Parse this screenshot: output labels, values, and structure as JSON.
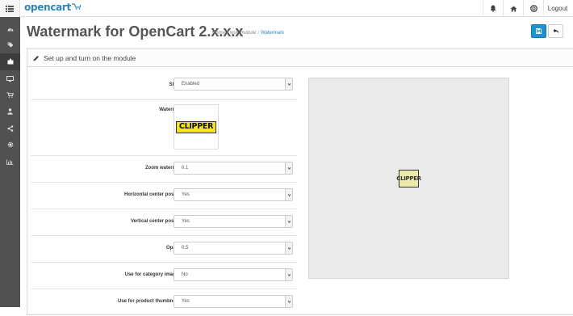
{
  "header": {
    "brand": "opencart",
    "logout_label": "Logout"
  },
  "page": {
    "title": "Watermark for OpenCart 2.x.x.x",
    "breadcrumb": [
      "Home",
      "test_module",
      "Watermark"
    ]
  },
  "panel": {
    "heading": "Set up and turn on the module"
  },
  "form": {
    "status": {
      "label": "Status",
      "value": "Enabled"
    },
    "watermark": {
      "label": "Watermark",
      "image_text": "CLIPPER"
    },
    "zoom": {
      "label": "Zoom watermark",
      "value": "0.1"
    },
    "h_center": {
      "label": "Horizontal center position",
      "value": "Yes"
    },
    "v_center": {
      "label": "Vertical center position",
      "value": "Yes"
    },
    "opacity": {
      "label": "Opacity",
      "value": "0.5"
    },
    "category": {
      "label": "Use for category images?",
      "value": "No"
    },
    "thumbs": {
      "label": "Use for product thumbnails?",
      "value": "Yes"
    }
  },
  "preview": {
    "watermark_text": "CLIPPER"
  },
  "icons": {
    "sidebar": [
      "dashboard-icon",
      "catalog-tag-icon",
      "extensions-puzzle-icon",
      "design-monitor-icon",
      "sales-cart-icon",
      "customers-user-icon",
      "marketing-share-icon",
      "system-cog-icon",
      "reports-chart-icon"
    ]
  },
  "colors": {
    "accent": "#1e91cf",
    "brand": "#2a86c2",
    "sidebar": "#515151",
    "watermark_yellow": "#f4e51c"
  }
}
